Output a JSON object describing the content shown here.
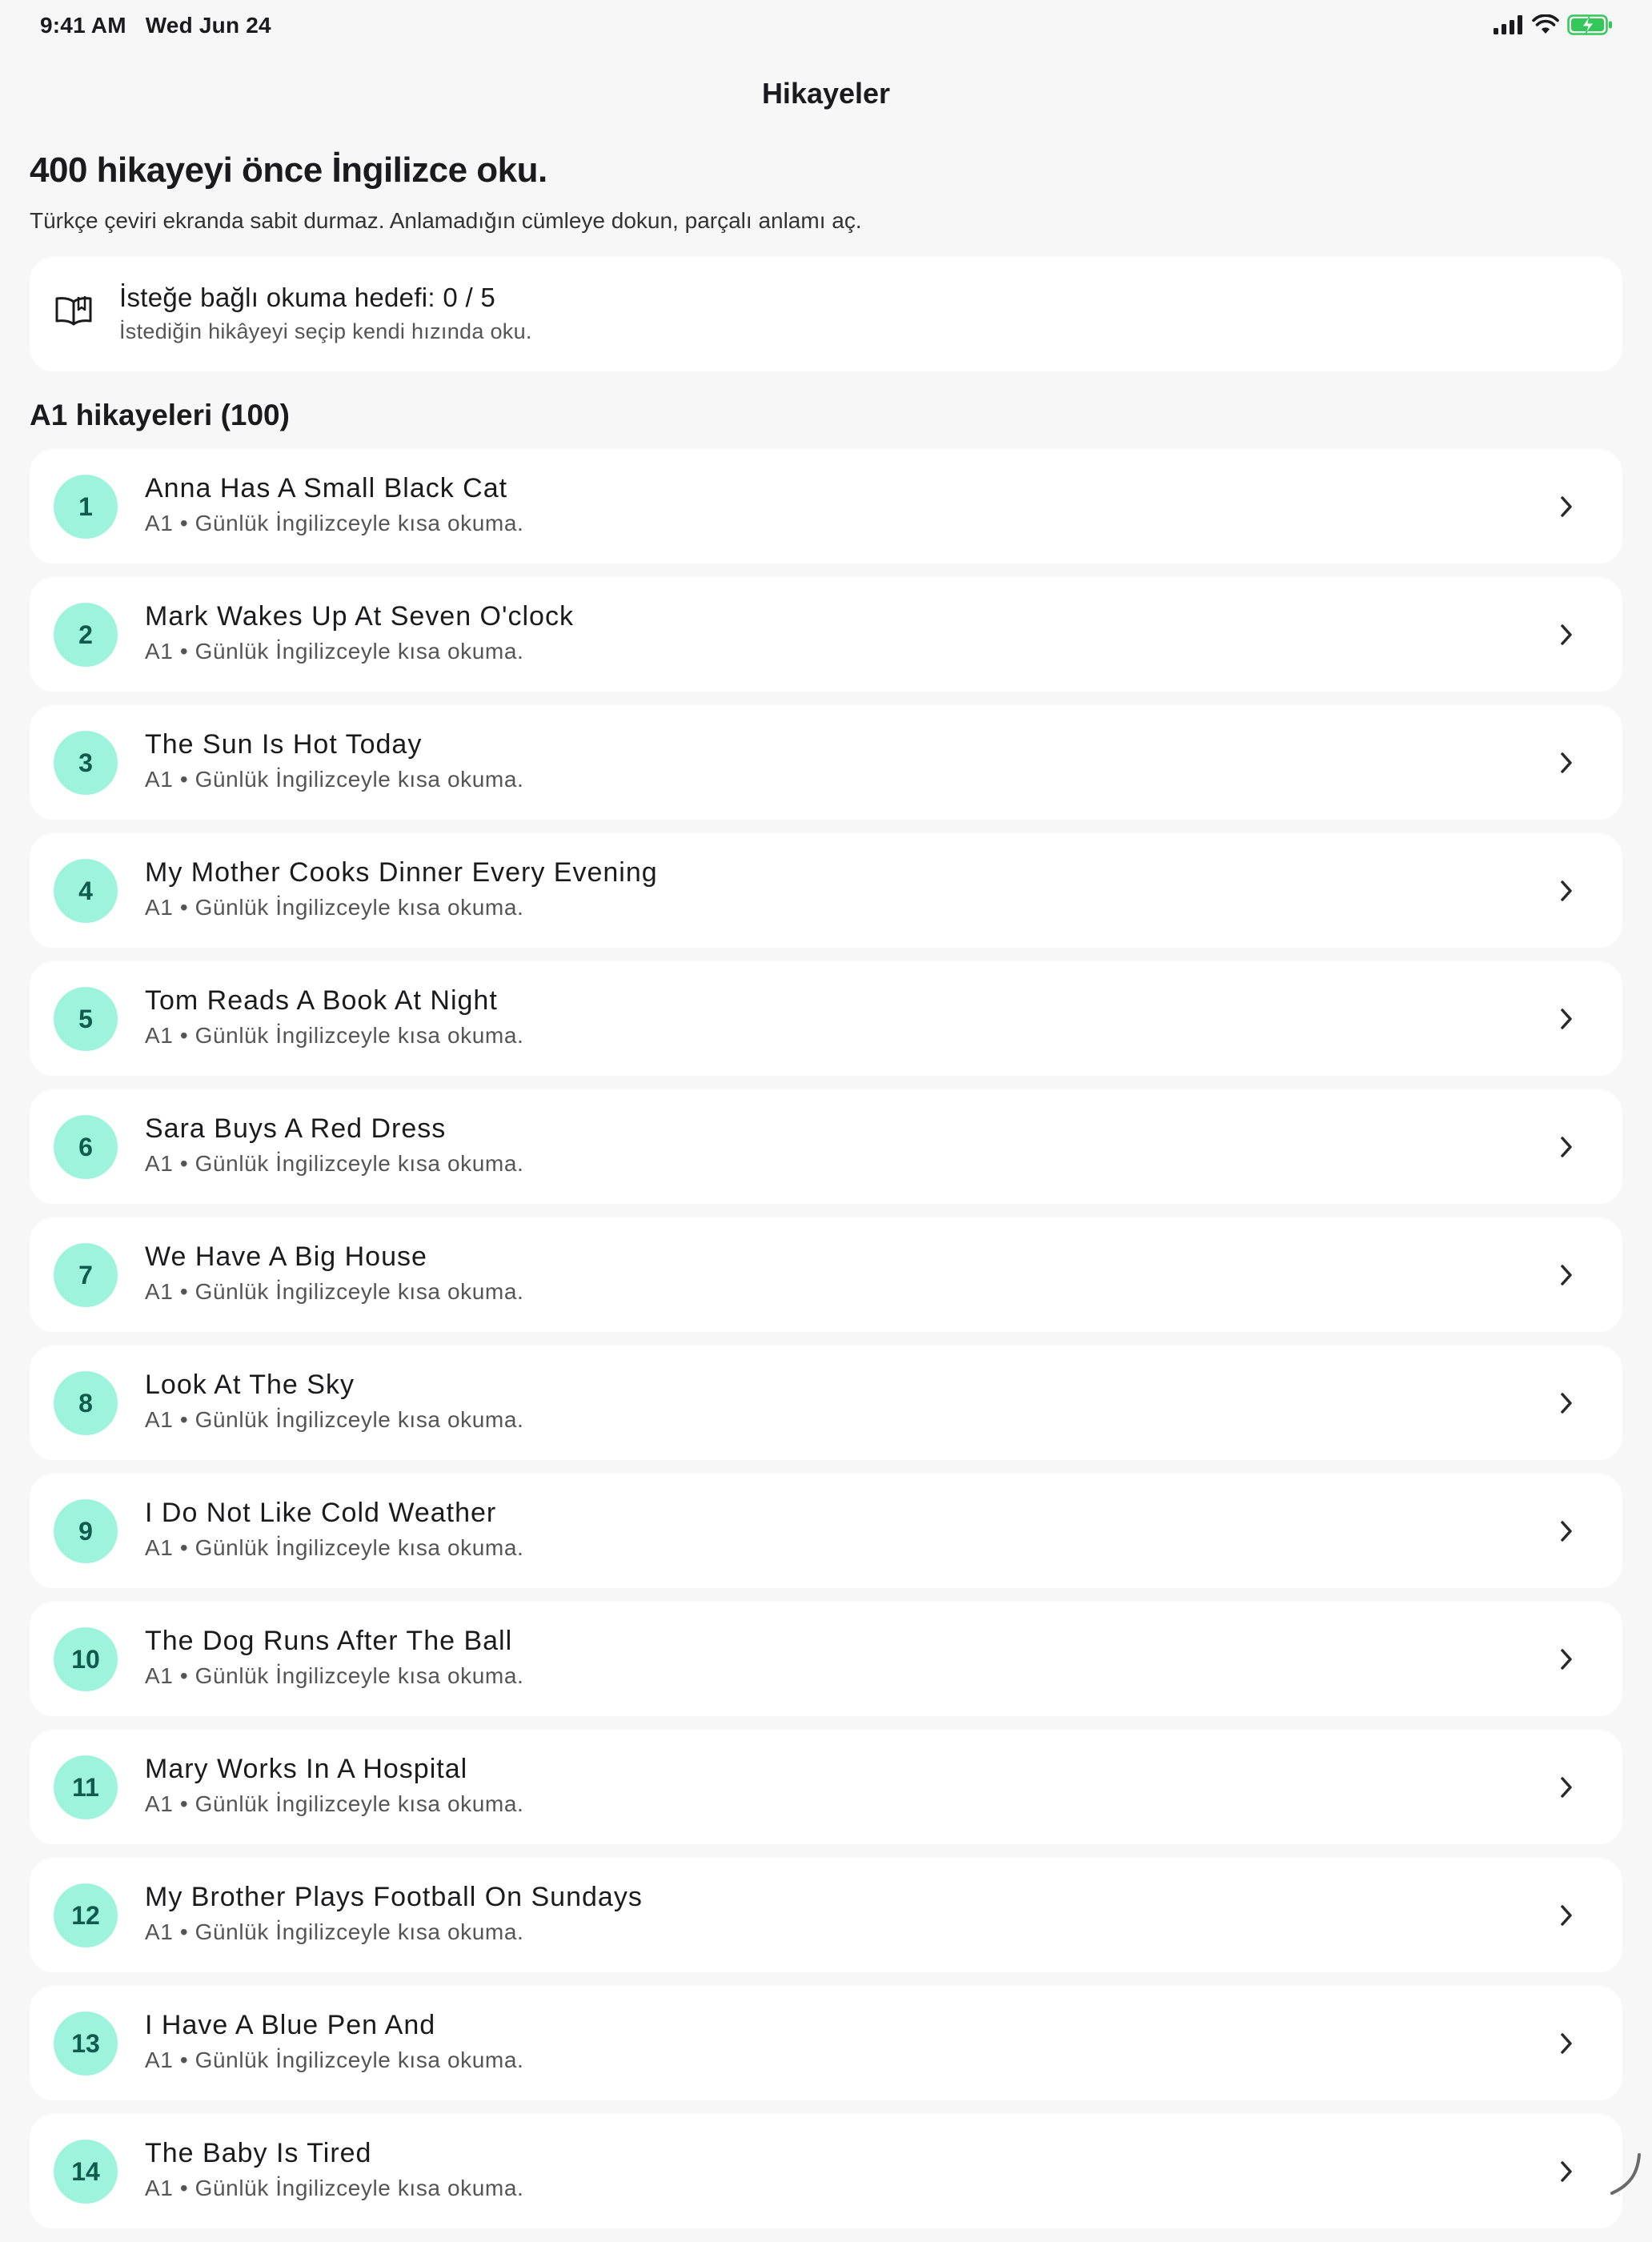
{
  "status_bar": {
    "time": "9:41 AM",
    "date": "Wed Jun 24",
    "icons": [
      "cellular-signal-icon",
      "wifi-icon",
      "battery-charging-icon"
    ]
  },
  "nav": {
    "title": "Hikayeler"
  },
  "header": {
    "heading": "400 hikayeyi önce İngilizce oku.",
    "subtitle": "Türkçe çeviri ekranda sabit durmaz. Anlamadığın cümleye dokun, parçalı anlamı aç."
  },
  "goal": {
    "icon": "book-icon",
    "title": "İsteğe bağlı okuma hedefi: 0 / 5",
    "subtitle": "İstediğin hikâyeyi seçip kendi hızında oku."
  },
  "section": {
    "title": "A1 hikayeleri (100)"
  },
  "colors": {
    "accent_badge": "#9ef3dd",
    "badge_text": "#0f5c4c",
    "battery_green": "#34c759"
  },
  "stories": [
    {
      "num": "1",
      "title": "Anna Has A Small Black Cat",
      "subtitle": "A1 • Günlük İngilizceyle kısa okuma."
    },
    {
      "num": "2",
      "title": "Mark Wakes Up At Seven O'clock",
      "subtitle": "A1 • Günlük İngilizceyle kısa okuma."
    },
    {
      "num": "3",
      "title": "The Sun Is Hot Today",
      "subtitle": "A1 • Günlük İngilizceyle kısa okuma."
    },
    {
      "num": "4",
      "title": "My Mother Cooks Dinner Every Evening",
      "subtitle": "A1 • Günlük İngilizceyle kısa okuma."
    },
    {
      "num": "5",
      "title": "Tom Reads A Book At Night",
      "subtitle": "A1 • Günlük İngilizceyle kısa okuma."
    },
    {
      "num": "6",
      "title": "Sara Buys A Red Dress",
      "subtitle": "A1 • Günlük İngilizceyle kısa okuma."
    },
    {
      "num": "7",
      "title": "We Have A Big House",
      "subtitle": "A1 • Günlük İngilizceyle kısa okuma."
    },
    {
      "num": "8",
      "title": "Look At The Sky",
      "subtitle": "A1 • Günlük İngilizceyle kısa okuma."
    },
    {
      "num": "9",
      "title": "I Do Not Like Cold Weather",
      "subtitle": "A1 • Günlük İngilizceyle kısa okuma."
    },
    {
      "num": "10",
      "title": "The Dog Runs After The Ball",
      "subtitle": "A1 • Günlük İngilizceyle kısa okuma."
    },
    {
      "num": "11",
      "title": "Mary Works In A Hospital",
      "subtitle": "A1 • Günlük İngilizceyle kısa okuma."
    },
    {
      "num": "12",
      "title": "My Brother Plays Football On Sundays",
      "subtitle": "A1 • Günlük İngilizceyle kısa okuma."
    },
    {
      "num": "13",
      "title": "I Have A Blue Pen And",
      "subtitle": "A1 • Günlük İngilizceyle kısa okuma."
    },
    {
      "num": "14",
      "title": "The Baby Is Tired",
      "subtitle": "A1 • Günlük İngilizceyle kısa okuma."
    }
  ]
}
